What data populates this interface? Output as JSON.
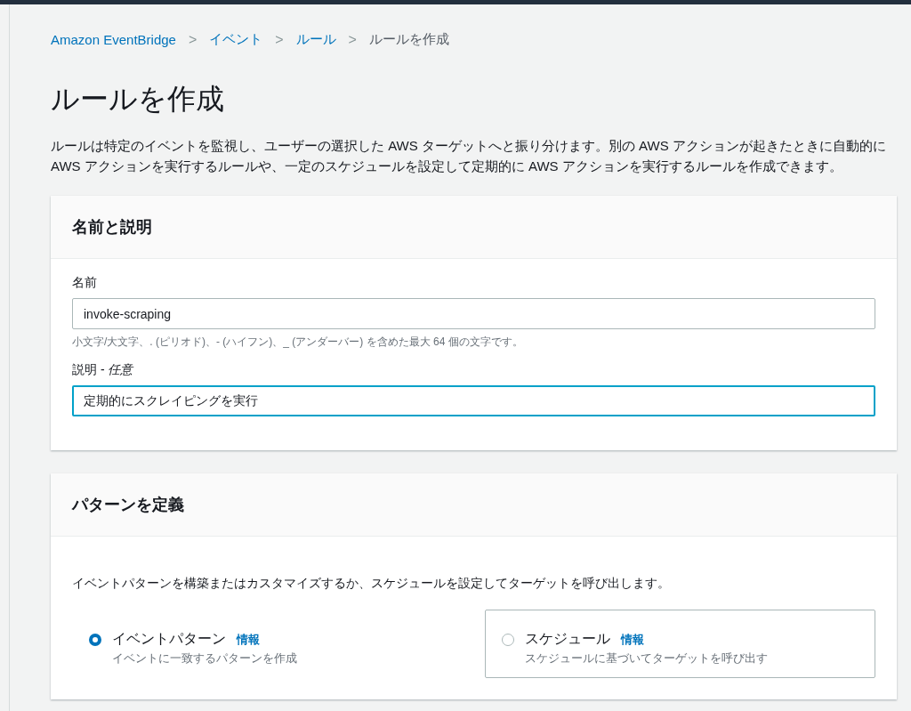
{
  "breadcrumbs": [
    {
      "label": "Amazon EventBridge",
      "link": true
    },
    {
      "label": "イベント",
      "link": true
    },
    {
      "label": "ルール",
      "link": true
    },
    {
      "label": "ルールを作成",
      "link": false
    }
  ],
  "breadcrumb_separator": ">",
  "title": "ルールを作成",
  "description": "ルールは特定のイベントを監視し、ユーザーの選択した AWS ターゲットへと振り分けます。別の AWS アクションが起きたときに自動的に AWS アクションを実行するルールや、一定のスケジュールを設定して定期的に AWS アクションを実行するルールを作成できます。",
  "name_section": {
    "title": "名前と説明",
    "fields": [
      {
        "label": "名前",
        "value": "invoke-scraping",
        "hint": "小文字/大文字、. (ピリオド)、- (ハイフン)、_ (アンダーバー) を含めた最大 64 個の文字です。",
        "focused": false
      },
      {
        "label": "説明 - *任意*",
        "value": "定期的にスクレイピングを実行",
        "focused": true
      }
    ]
  },
  "pattern_section": {
    "title": "パターンを定義",
    "intro": "イベントパターンを構築またはカスタマイズするか、スケジュールを設定してターゲットを呼び出します。",
    "options": [
      {
        "label": "イベントパターン",
        "info": "情報",
        "sub": "イベントに一致するパターンを作成",
        "selected": true
      },
      {
        "label": "スケジュール",
        "info": "情報",
        "sub": "スケジュールに基づいてターゲットを呼び出す",
        "selected": false
      }
    ]
  }
}
